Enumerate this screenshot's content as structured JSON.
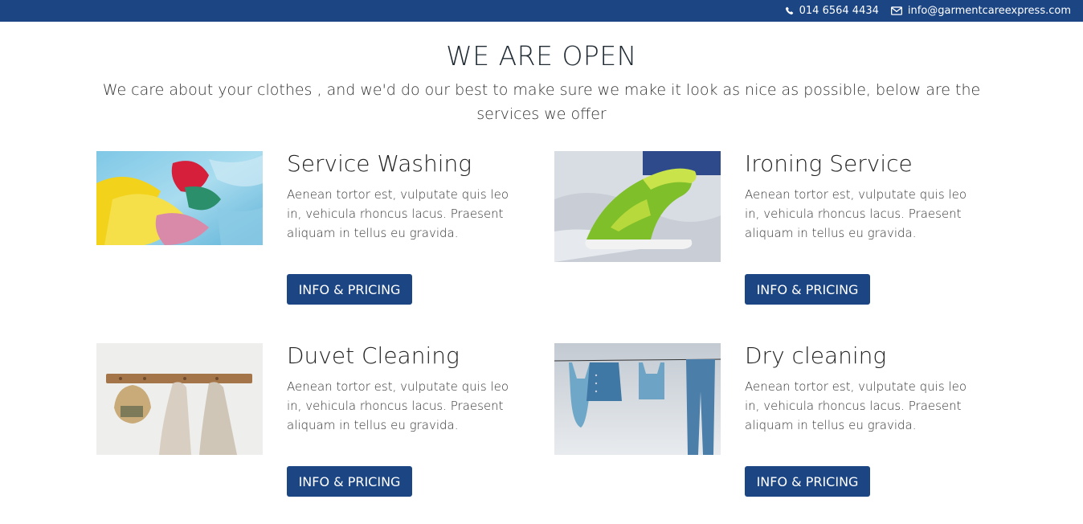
{
  "topbar": {
    "phone": "014 6564 4434",
    "email": "info@garmentcareexpress.com",
    "phone_icon": "phone-icon",
    "email_icon": "envelope-icon",
    "bg_color": "#1c4584"
  },
  "hero": {
    "title": "WE ARE OPEN",
    "subtitle": "We care about your clothes , and we'd do our best to make sure we make it look as nice as possible, below are the services we offer"
  },
  "services": [
    {
      "title": "Service Washing",
      "text": "Aenean tortor est, vulputate quis leo in, vehicula rhoncus lacus. Praesent aliquam in tellus eu gravida.",
      "button": "INFO & PRICING",
      "image": "washing-photo"
    },
    {
      "title": "Ironing Service",
      "text": "Aenean tortor est, vulputate quis leo in, vehicula rhoncus lacus. Praesent aliquam in tellus eu gravida.",
      "button": "INFO & PRICING",
      "image": "iron-photo"
    },
    {
      "title": "Duvet Cleaning",
      "text": "Aenean tortor est, vulputate quis leo in, vehicula rhoncus lacus. Praesent aliquam in tellus eu gravida.",
      "button": "INFO & PRICING",
      "image": "towels-photo"
    },
    {
      "title": "Dry cleaning",
      "text": "Aenean tortor est, vulputate quis leo in, vehicula rhoncus lacus. Praesent aliquam in tellus eu gravida.",
      "button": "INFO & PRICING",
      "image": "clothesline-photo"
    }
  ],
  "accent_color": "#1c4584"
}
